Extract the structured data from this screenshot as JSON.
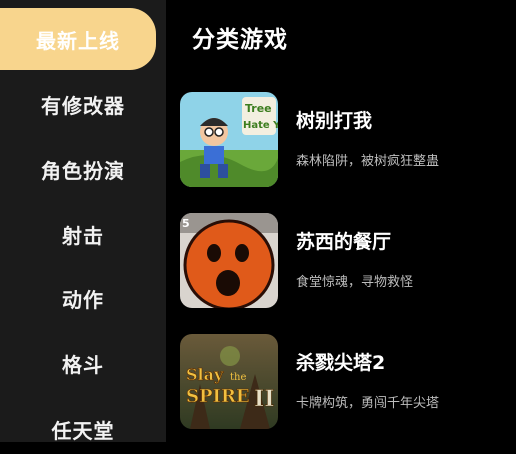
{
  "sidebar": {
    "items": [
      {
        "label": "最新上线",
        "active": true
      },
      {
        "label": "有修改器"
      },
      {
        "label": "角色扮演"
      },
      {
        "label": "射击"
      },
      {
        "label": "动作"
      },
      {
        "label": "格斗"
      },
      {
        "label": "任天堂"
      }
    ]
  },
  "main": {
    "title": "分类游戏",
    "games": [
      {
        "name": "树别打我",
        "desc": "森林陷阱，被树疯狂整蛊",
        "thumb_text_1": "Tree",
        "thumb_text_2": "Hate Y"
      },
      {
        "name": "苏西的餐厅",
        "desc": "食堂惊魂，寻物救怪",
        "thumb_text": "5"
      },
      {
        "name": "杀戮尖塔2",
        "desc": "卡牌构筑，勇闯千年尖塔",
        "thumb_text_1": "Slay",
        "thumb_text_2": "the",
        "thumb_text_3": "SPIRE",
        "thumb_text_4": "II"
      }
    ]
  },
  "colors": {
    "active_tab": "#f8d58d",
    "sidebar_bg": "#1b1b1b",
    "bg": "#000000"
  }
}
